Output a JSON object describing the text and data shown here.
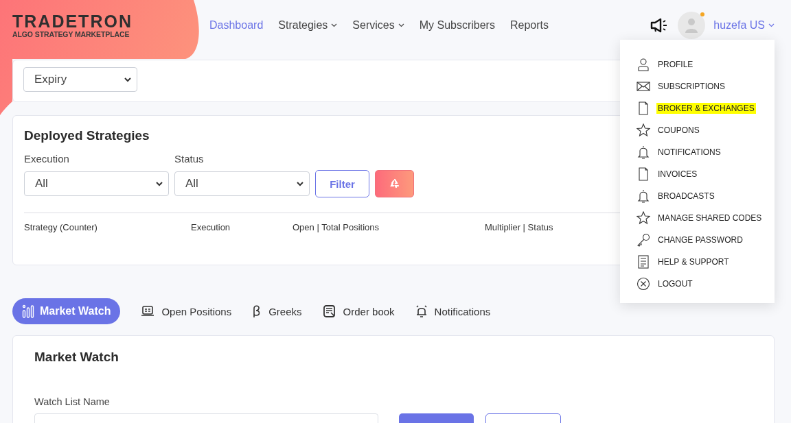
{
  "header": {
    "logo": {
      "name": "TRADETRON",
      "tagline": "ALGO STRATEGY MARKETPLACE"
    },
    "nav": [
      {
        "label": "Dashboard",
        "selected": true,
        "has_menu": false
      },
      {
        "label": "Strategies",
        "selected": false,
        "has_menu": true
      },
      {
        "label": "Services",
        "selected": false,
        "has_menu": true
      },
      {
        "label": "My Subscribers",
        "selected": false,
        "has_menu": false
      },
      {
        "label": "Reports",
        "selected": false,
        "has_menu": false
      }
    ],
    "user": {
      "name": "huzefa US",
      "has_notification": true
    }
  },
  "user_menu": {
    "items": [
      {
        "label": "PROFILE",
        "highlighted": false
      },
      {
        "label": "SUBSCRIPTIONS",
        "highlighted": false
      },
      {
        "label": "BROKER & EXCHANGES",
        "highlighted": true
      },
      {
        "label": "COUPONS",
        "highlighted": false
      },
      {
        "label": "NOTIFICATIONS",
        "highlighted": false
      },
      {
        "label": "INVOICES",
        "highlighted": false
      },
      {
        "label": "BROADCASTS",
        "highlighted": false
      },
      {
        "label": "MANAGE SHARED CODES",
        "highlighted": false
      },
      {
        "label": "CHANGE PASSWORD",
        "highlighted": false
      },
      {
        "label": "HELP & SUPPORT",
        "highlighted": false
      },
      {
        "label": "LOGOUT",
        "highlighted": false
      }
    ]
  },
  "expiry_select": {
    "value": "Expiry"
  },
  "deployed_strategies": {
    "title": "Deployed Strategies",
    "filters": [
      {
        "label": "Execution",
        "value": "All"
      },
      {
        "label": "Status",
        "value": "All"
      }
    ],
    "filter_button": "Filter",
    "columns": [
      "Strategy (Counter)",
      "Execution",
      "Open | Total Positions",
      "Multiplier | Status"
    ]
  },
  "tabs": [
    {
      "label": "Market Watch",
      "selected": true
    },
    {
      "label": "Open Positions",
      "selected": false
    },
    {
      "label": "Greeks",
      "selected": false
    },
    {
      "label": "Order book",
      "selected": false
    },
    {
      "label": "Notifications",
      "selected": false
    }
  ],
  "market_watch": {
    "title": "Market Watch",
    "field_label": "Watch List Name"
  }
}
